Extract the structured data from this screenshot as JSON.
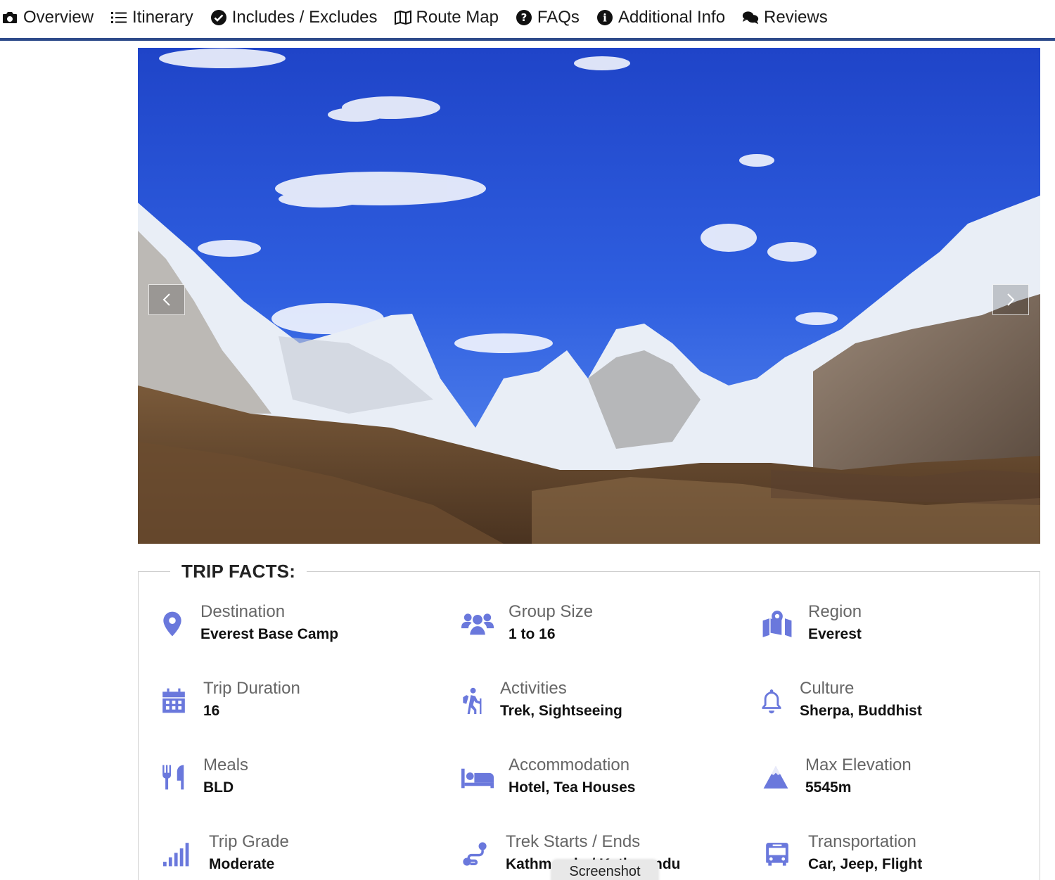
{
  "nav": {
    "tabs": [
      {
        "label": "Overview",
        "icon": "camera-icon"
      },
      {
        "label": "Itinerary",
        "icon": "list-icon"
      },
      {
        "label": "Includes / Excludes",
        "icon": "check-circle-icon"
      },
      {
        "label": "Route Map",
        "icon": "map-icon"
      },
      {
        "label": "FAQs",
        "icon": "question-circle-icon"
      },
      {
        "label": "Additional Info",
        "icon": "info-circle-icon"
      },
      {
        "label": "Reviews",
        "icon": "comments-icon"
      }
    ],
    "underline_color": "#2d4a8a"
  },
  "hero": {
    "prev_icon": "chevron-left-icon",
    "next_icon": "chevron-right-icon"
  },
  "trip_facts": {
    "title": "TRIP FACTS:",
    "icon_color": "#6a78dc",
    "items": [
      {
        "label": "Destination",
        "value": "Everest Base Camp",
        "icon": "map-pin-icon"
      },
      {
        "label": "Group Size",
        "value": "1 to 16",
        "icon": "users-icon"
      },
      {
        "label": "Region",
        "value": "Everest",
        "icon": "map-marked-icon"
      },
      {
        "label": "Trip Duration",
        "value": "16",
        "icon": "calendar-icon"
      },
      {
        "label": "Activities",
        "value": "Trek, Sightseeing",
        "icon": "hiking-icon"
      },
      {
        "label": "Culture",
        "value": "Sherpa, Buddhist",
        "icon": "bell-icon"
      },
      {
        "label": "Meals",
        "value": "BLD",
        "icon": "utensils-icon"
      },
      {
        "label": "Accommodation",
        "value": "Hotel, Tea Houses",
        "icon": "bed-icon"
      },
      {
        "label": "Max Elevation",
        "value": "5545m",
        "icon": "mountain-icon"
      },
      {
        "label": "Trip Grade",
        "value": "Moderate",
        "icon": "signal-icon"
      },
      {
        "label": "Trek Starts / Ends",
        "value": "Kathmandu / Kathmandu",
        "icon": "route-icon"
      },
      {
        "label": "Transportation",
        "value": "Car, Jeep, Flight",
        "icon": "bus-icon"
      }
    ]
  },
  "tooltip": {
    "text": "Screenshot"
  }
}
